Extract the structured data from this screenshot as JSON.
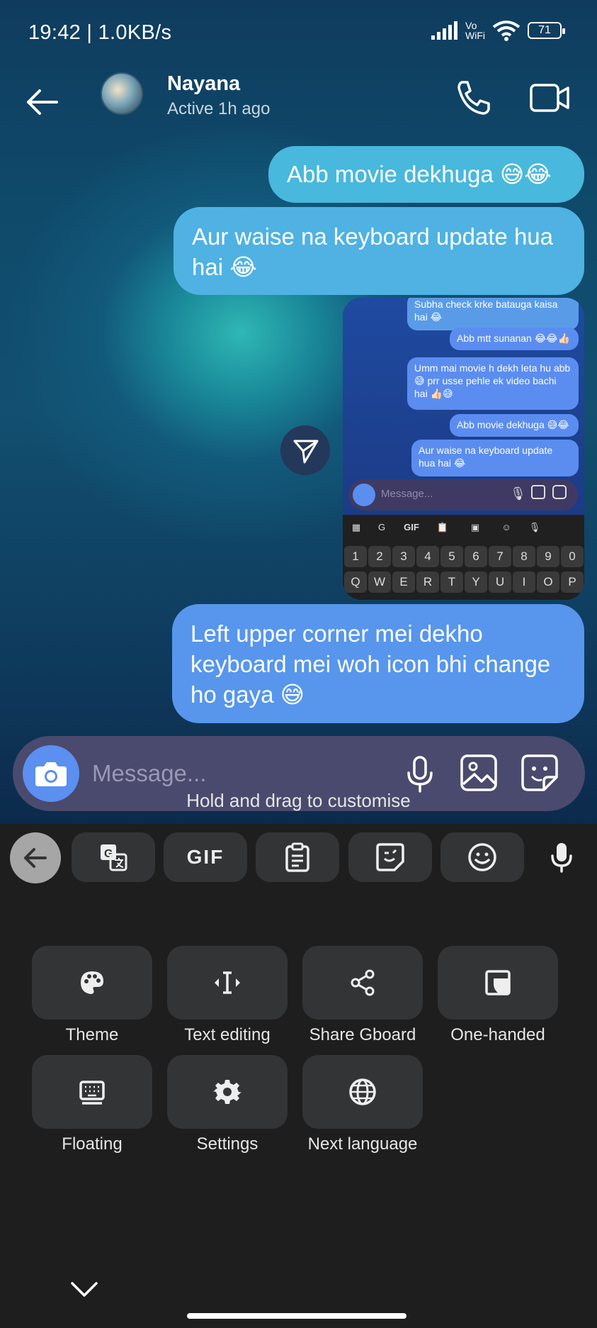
{
  "status_bar": {
    "time": "19:42 | 1.0KB/s",
    "vowifi_top": "Vo",
    "vowifi_bottom": "WiFi",
    "battery": "71"
  },
  "header": {
    "name": "Nayana",
    "status": "Active 1h ago"
  },
  "messages": [
    "Abb movie dekhuga 😅😂",
    "Aur waise na keyboard update hua hai 😂",
    "Left upper corner mei dekho keyboard mei woh icon bhi change ho gaya 😅"
  ],
  "screenshot_preview": {
    "messages": [
      "Subha check krke bataugа kaisa hai 😂",
      "Abb mtt sunanan 😂😂👍🏻",
      "Umm mai movie h dekh leta hu abb 😅 prr usse pehle ek video bachi hai 👍🏻😅",
      "Abb movie dekhuga 😅😂",
      "Aur waise na keyboard update hua hai 😂"
    ],
    "placeholder": "Message...",
    "toolbar": [
      "GIF"
    ],
    "number_row": [
      "1",
      "2",
      "3",
      "4",
      "5",
      "6",
      "7",
      "8",
      "9",
      "0"
    ],
    "letter_row": [
      "Q",
      "W",
      "E",
      "R",
      "T",
      "Y",
      "U",
      "I",
      "O",
      "P"
    ]
  },
  "composer": {
    "placeholder": "Message..."
  },
  "keyboard": {
    "toolbar_gif": "GIF",
    "hint": "Hold and drag to customise",
    "tiles": [
      {
        "label": "Theme",
        "icon": "palette-icon"
      },
      {
        "label": "Text editing",
        "icon": "text-cursor-icon"
      },
      {
        "label": "Share Gboard",
        "icon": "share-icon"
      },
      {
        "label": "One-handed",
        "icon": "one-handed-icon"
      },
      {
        "label": "Floating",
        "icon": "floating-keyboard-icon"
      },
      {
        "label": "Settings",
        "icon": "gear-icon"
      },
      {
        "label": "Next language",
        "icon": "globe-icon"
      }
    ]
  },
  "colors": {
    "bubble_top": "#49b8dd",
    "bubble_bottom": "#5796ec",
    "keyboard_bg": "#1e1e1e",
    "tile_bg": "#333436"
  }
}
